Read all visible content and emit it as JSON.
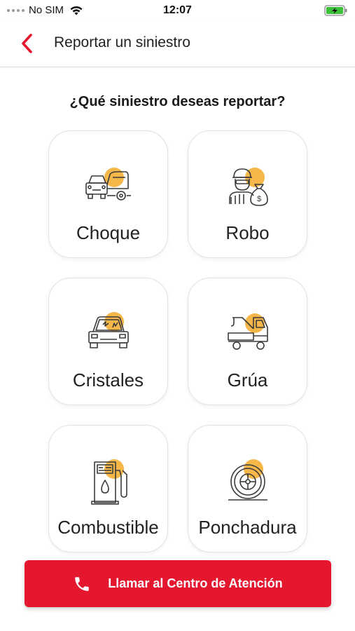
{
  "status_bar": {
    "carrier": "No SIM",
    "time": "12:07"
  },
  "header": {
    "title": "Reportar un siniestro",
    "back_icon": "chevron-left-icon"
  },
  "question": "¿Qué siniestro deseas reportar?",
  "options": [
    {
      "label": "Choque",
      "icon": "car-crash-icon"
    },
    {
      "label": "Robo",
      "icon": "thief-icon"
    },
    {
      "label": "Cristales",
      "icon": "broken-windshield-icon"
    },
    {
      "label": "Grúa",
      "icon": "tow-truck-icon"
    },
    {
      "label": "Combustible",
      "icon": "fuel-pump-icon"
    },
    {
      "label": "Ponchadura",
      "icon": "flat-tire-icon"
    }
  ],
  "call_button": {
    "label": "Llamar al Centro de Atención",
    "icon": "phone-icon"
  },
  "colors": {
    "accent": "#e4172f",
    "icon_highlight": "#f5b74a",
    "icon_stroke": "#3a3a3a"
  }
}
